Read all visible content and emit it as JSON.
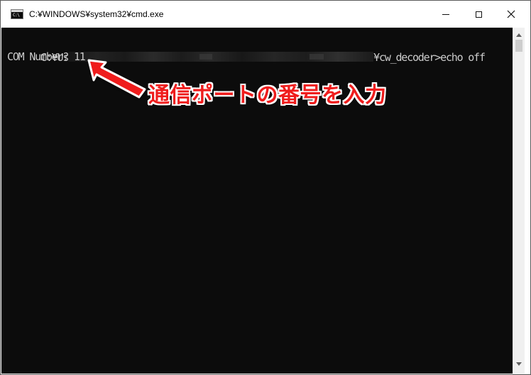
{
  "window": {
    "title": "C:¥WINDOWS¥system32¥cmd.exe",
    "icon_text": "C:\\",
    "controls": {
      "minimize_icon": "minimize-icon",
      "maximize_icon": "maximize-icon",
      "close_icon": "close-icon"
    }
  },
  "console": {
    "line1_prefix": "C:¥Us",
    "line1_suffix": "¥cw_decoder>echo off",
    "line2": "COM Number? 11"
  },
  "annotation": {
    "text": "通信ポートの番号を入力",
    "color": "#ef1d1d"
  },
  "colors": {
    "console_background": "#0c0c0c",
    "console_text": "#cccccc",
    "titlebar": "#ffffff",
    "annotation": "#ef1d1d"
  }
}
